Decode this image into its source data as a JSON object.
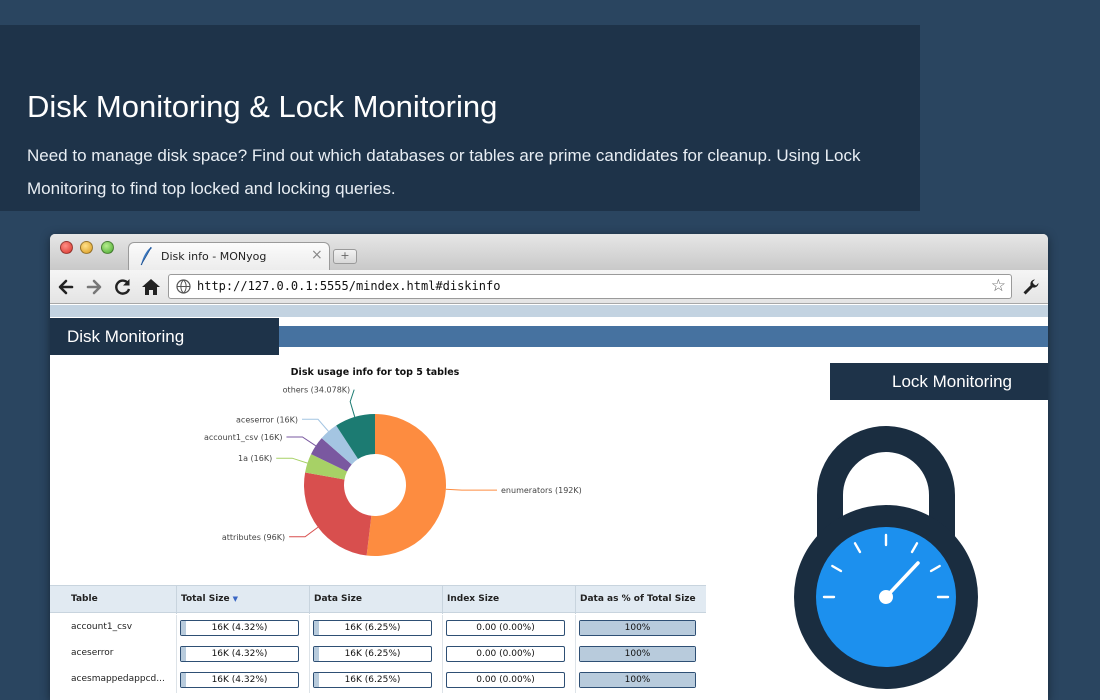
{
  "hero": {
    "title": "Disk Monitoring & Lock Monitoring",
    "description": "Need to manage disk space? Find out which databases or tables are prime candidates for cleanup. Using Lock Monitoring to find top locked and locking queries."
  },
  "browser": {
    "tab_title": "Disk info - MONyog",
    "new_tab_symbol": "+",
    "close_symbol": "×",
    "url": "http://127.0.0.1:5555/mindex.html#diskinfo",
    "icons": [
      "back-arrow-icon",
      "forward-arrow-icon",
      "reload-icon",
      "home-icon",
      "globe-icon",
      "star-icon",
      "wrench-icon",
      "feather-icon"
    ]
  },
  "page": {
    "disk_header": "Disk Monitoring",
    "lock_header": "Lock Monitoring",
    "colors": {
      "dark_navy": "#1e3349",
      "band_blue": "#4672a0",
      "lock_dial": "#1c90ee"
    }
  },
  "chart_data": {
    "type": "pie",
    "donut": true,
    "title": "Disk usage info for top 5 tables",
    "slices": [
      {
        "label": "enumerators (192K)",
        "value": 192,
        "color": "#fd8c40"
      },
      {
        "label": "attributes (96K)",
        "value": 96,
        "color": "#d84f4e"
      },
      {
        "label": "1a (16K)",
        "value": 16,
        "color": "#a7d166"
      },
      {
        "label": "account1_csv (16K)",
        "value": 16,
        "color": "#7a58a0"
      },
      {
        "label": "aceserror (16K)",
        "value": 16,
        "color": "#a4c5e2"
      },
      {
        "label": "others (34.078K)",
        "value": 34.078,
        "color": "#1c7b72"
      }
    ]
  },
  "table": {
    "columns": [
      "Table",
      "Total Size",
      "Data Size",
      "Index Size",
      "Data as % of Total Size"
    ],
    "sort_indicator": "▼",
    "rows": [
      {
        "name": "account1_csv",
        "total": "16K (4.32%)",
        "total_pct": 0.0432,
        "data": "16K (6.25%)",
        "data_pct": 0.0625,
        "index": "0.00 (0.00%)",
        "index_pct": 0,
        "data_share": "100%",
        "data_share_pct": 1
      },
      {
        "name": "aceserror",
        "total": "16K (4.32%)",
        "total_pct": 0.0432,
        "data": "16K (6.25%)",
        "data_pct": 0.0625,
        "index": "0.00 (0.00%)",
        "index_pct": 0,
        "data_share": "100%",
        "data_share_pct": 1
      },
      {
        "name": "acesmappedappcd...",
        "total": "16K (4.32%)",
        "total_pct": 0.0432,
        "data": "16K (6.25%)",
        "data_pct": 0.0625,
        "index": "0.00 (0.00%)",
        "index_pct": 0,
        "data_share": "100%",
        "data_share_pct": 1
      }
    ]
  }
}
